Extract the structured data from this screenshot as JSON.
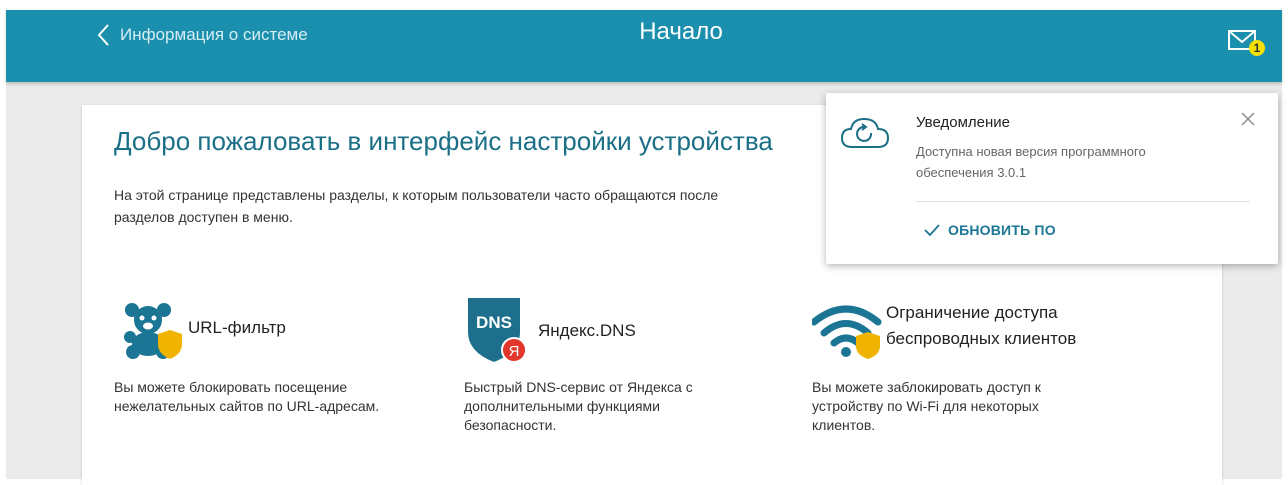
{
  "header": {
    "back_label": "Информация о системе",
    "title": "Начало",
    "notifications_count": "1"
  },
  "welcome": {
    "title": "Добро пожаловать в интерфейс настройки устройства",
    "description_line1": "На этой странице представлены разделы, к которым пользователи часто обращаются после",
    "description_line2": "разделов доступен в меню."
  },
  "features": [
    {
      "icon": "teddy-bear-shield-icon",
      "title": "URL-фильтр",
      "description": [
        "Вы можете блокировать посещение",
        "нежелательных сайтов по URL-адресам."
      ]
    },
    {
      "icon": "dns-shield-yandex-icon",
      "icon_text": "DNS",
      "badge_text": "Я",
      "title": "Яндекс.DNS",
      "description": [
        "Быстрый DNS-сервис от Яндекса с",
        "дополнительными функциями",
        "безопасности."
      ]
    },
    {
      "icon": "wifi-shield-icon",
      "title_lines": [
        "Ограничение доступа",
        "беспроводных клиентов"
      ],
      "description": [
        "Вы можете заблокировать доступ к",
        "устройству по Wi-Fi для некоторых",
        "клиентов."
      ]
    }
  ],
  "notification": {
    "icon": "cloud-refresh-icon",
    "title": "Уведомление",
    "text_line1": "Доступна новая версия программного",
    "text_line2": "обеспечения 3.0.1",
    "action_label": "ОБНОВИТЬ ПО"
  },
  "colors": {
    "header_bg": "#1b8fae",
    "accent": "#1b6f86",
    "badge": "#f5e100",
    "shield": "#f0b400",
    "dns_blue": "#1d6f8c",
    "yandex_red": "#e2352b"
  }
}
